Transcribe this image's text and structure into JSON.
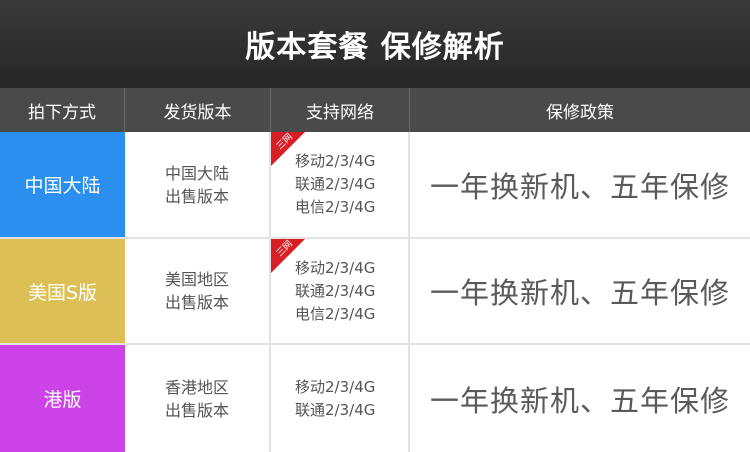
{
  "title": "版本套餐 保修解析",
  "columns": [
    "拍下方式",
    "发货版本",
    "支持网络",
    "保修政策"
  ],
  "colors": {
    "header_bg": "#2e2e2e",
    "column_header_bg": "#4a4a4a",
    "mainland": "#2b8ff0",
    "us": "#dcc055",
    "hk": "#cc44e8",
    "ribbon": "#d91f26"
  },
  "rows": [
    {
      "region": "中国大陆",
      "version": [
        "中国大陆",
        "出售版本"
      ],
      "networks": [
        "移动2/3/4G",
        "联通2/3/4G",
        "电信2/3/4G"
      ],
      "ribbon": "三网",
      "policy": "一年换新机、五年保修"
    },
    {
      "region": "美国S版",
      "version": [
        "美国地区",
        "出售版本"
      ],
      "networks": [
        "移动2/3/4G",
        "联通2/3/4G",
        "电信2/3/4G"
      ],
      "ribbon": "三网",
      "policy": "一年换新机、五年保修"
    },
    {
      "region": "港版",
      "version": [
        "香港地区",
        "出售版本"
      ],
      "networks": [
        "移动2/3/4G",
        "联通2/3/4G"
      ],
      "policy": "一年换新机、五年保修"
    }
  ]
}
